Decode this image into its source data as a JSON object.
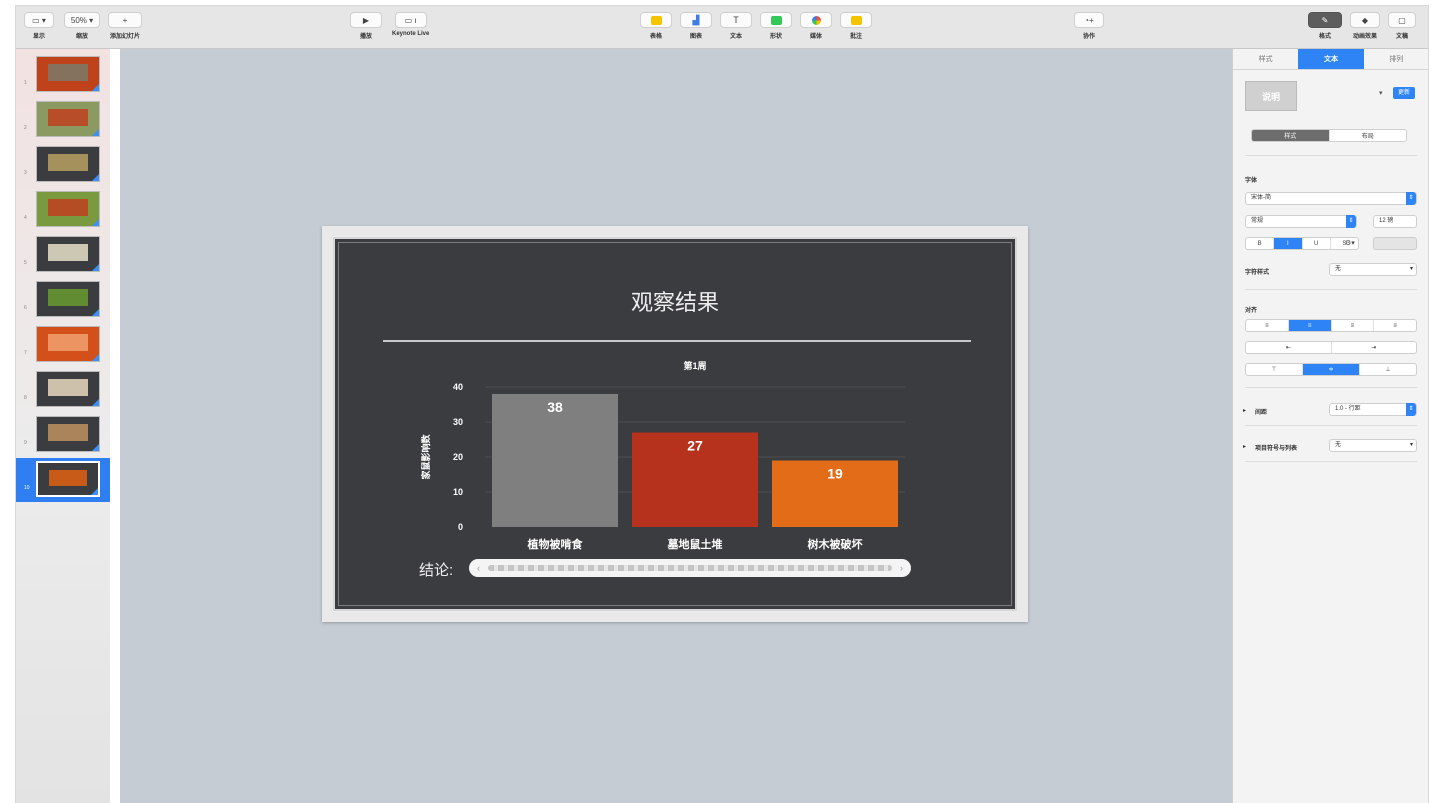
{
  "toolbar": {
    "left": [
      {
        "label": "显示",
        "icon": "sidebar-icon",
        "text": "▭ ▾"
      },
      {
        "label": "缩放",
        "icon": "zoom-icon",
        "text": "50% ▾"
      },
      {
        "label": "添加幻灯片",
        "icon": "plus-icon",
        "text": "+"
      }
    ],
    "middle": [
      {
        "label": "播放",
        "icon": "play-icon",
        "text": "▶"
      },
      {
        "label": "Keynote Live",
        "icon": "keynote-live-icon",
        "text": "▭ ı"
      }
    ],
    "insert": [
      {
        "label": "表格",
        "icon": "table-icon",
        "color": "#f5c400"
      },
      {
        "label": "图表",
        "icon": "chart-icon",
        "color": "#3a7ee6"
      },
      {
        "label": "文本",
        "icon": "text-icon",
        "color": ""
      },
      {
        "label": "形状",
        "icon": "shape-icon",
        "color": "#34c759"
      },
      {
        "label": "媒体",
        "icon": "media-icon",
        "color": "#e94f3d"
      },
      {
        "label": "批注",
        "icon": "comment-icon",
        "color": "#f5c400"
      }
    ],
    "collab": {
      "label": "协作",
      "icon": "collaborate-icon"
    },
    "right": [
      {
        "label": "格式",
        "icon": "format-icon",
        "text": "✎"
      },
      {
        "label": "动画效果",
        "icon": "animate-icon",
        "text": "◆"
      },
      {
        "label": "文稿",
        "icon": "document-icon",
        "text": "▢"
      }
    ]
  },
  "navigator": {
    "slides": [
      {
        "num": "1",
        "bg": "#c0421b",
        "accent": "#7a7a6a"
      },
      {
        "num": "2",
        "bg": "#8a9a60",
        "accent": "#c04020"
      },
      {
        "num": "3",
        "bg": "#3a3c3f",
        "accent": "#b8a060"
      },
      {
        "num": "4",
        "bg": "#7a9a40",
        "accent": "#c04020"
      },
      {
        "num": "5",
        "bg": "#3a3c3f",
        "accent": "#e8e0c8"
      },
      {
        "num": "6",
        "bg": "#3a3c3f",
        "accent": "#6a9a30"
      },
      {
        "num": "7",
        "bg": "#d4501a",
        "accent": "#f0a070"
      },
      {
        "num": "8",
        "bg": "#3a3c3f",
        "accent": "#e8d8c0"
      },
      {
        "num": "9",
        "bg": "#3a3c3f",
        "accent": "#c09060"
      },
      {
        "num": "10",
        "bg": "#3a3c3f",
        "accent": "#e06010"
      }
    ]
  },
  "slide": {
    "title": "观察结果",
    "conclusion": "结论:",
    "scroller_left": "‹",
    "scroller_right": "›"
  },
  "chart_data": {
    "type": "bar",
    "title": "第1周",
    "ylabel": "家鼠影响数",
    "categories": [
      "植物被啃食",
      "墓地鼠土堆",
      "树木被破坏"
    ],
    "values": [
      38,
      27,
      19
    ],
    "colors": [
      "#7f7f7f",
      "#b7321c",
      "#e26c18"
    ],
    "yticks": [
      0,
      10,
      20,
      30,
      40
    ],
    "ylim": [
      0,
      40
    ],
    "grid": true
  },
  "inspector": {
    "tabs": [
      "样式",
      "文本",
      "排列"
    ],
    "active_tab": "文本",
    "style_preview": "说明",
    "update_button": "更新",
    "mode_tabs": [
      "样式",
      "布局"
    ],
    "font_section": "字体",
    "font_name": "宋体-简",
    "font_weight": "常规",
    "font_size": "12 磅",
    "char_style_label": "字符样式",
    "char_style_value": "无",
    "align_label": "对齐",
    "spacing_label": "间距",
    "spacing_value": "1.0 - 行距",
    "bullets_label": "项目符号与列表",
    "bullets_value": "无",
    "format_buttons": [
      "B",
      "I",
      "U",
      "S"
    ],
    "align_buttons": [
      "≡",
      "≡",
      "≡",
      "≡"
    ],
    "indent_buttons": [
      "⇤",
      "⇥"
    ],
    "valign_buttons": [
      "⊤",
      "≑",
      "⊥"
    ]
  }
}
